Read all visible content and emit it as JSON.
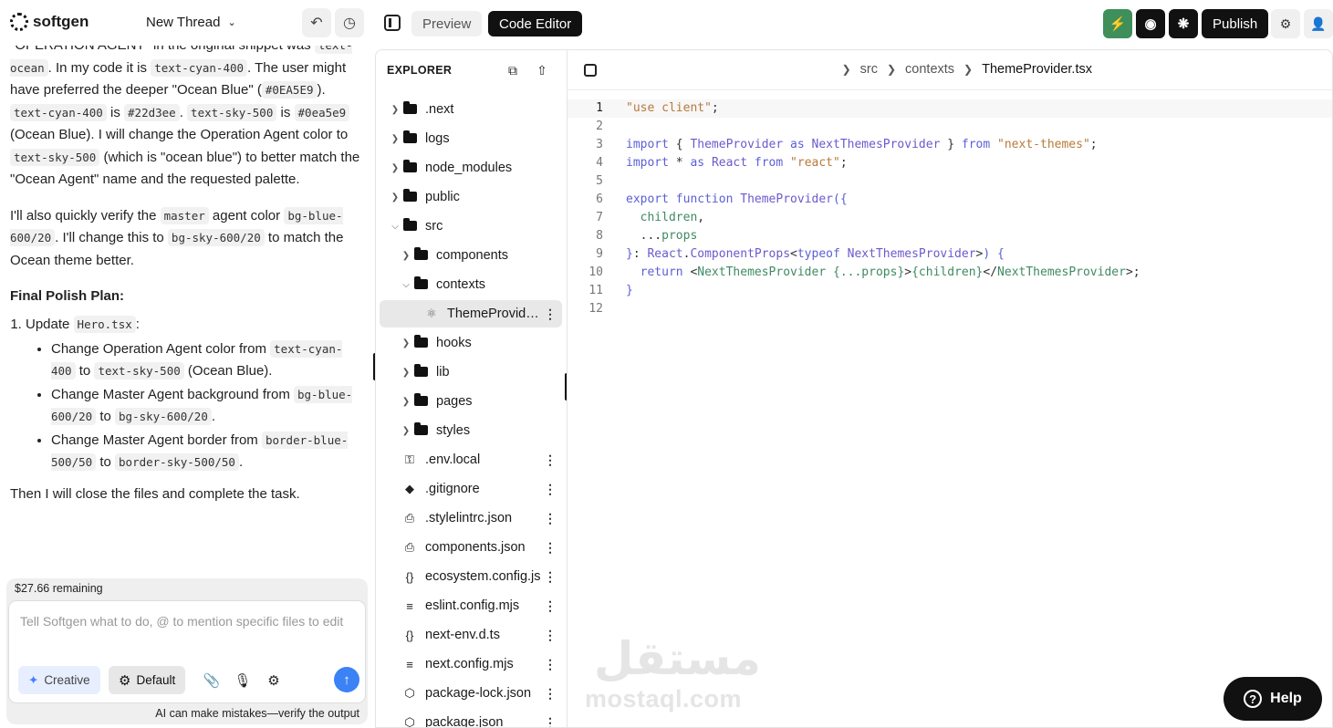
{
  "app": {
    "brand": "softgen",
    "thread_title": "New Thread"
  },
  "chat": {
    "p1": [
      "\"OPERATION AGENT\" in the original snippet was ",
      "text-ocean",
      ". In my code it is ",
      "text-cyan-400",
      ". The user might have preferred the deeper \"Ocean Blue\" (",
      "#0EA5E9",
      "). ",
      "text-cyan-400",
      " is ",
      "#22d3ee",
      ". ",
      "text-sky-500",
      " is ",
      "#0ea5e9",
      " (Ocean Blue). I will change the Operation Agent color to ",
      "text-sky-500",
      " (which is \"ocean blue\") to better match the \"Ocean Agent\" name and the requested palette."
    ],
    "p2": [
      "I'll also quickly verify the ",
      "master",
      " agent color ",
      "bg-blue-600/20",
      ". I'll change this to ",
      "bg-sky-600/20",
      " to match the Ocean theme better."
    ],
    "plan_title": "Final Polish Plan:",
    "step1": [
      "Update ",
      "Hero.tsx",
      ":"
    ],
    "bullets": [
      [
        "Change Operation Agent color from ",
        "text-cyan-400",
        " to ",
        "text-sky-500",
        " (Ocean Blue)."
      ],
      [
        "Change Master Agent background from ",
        "bg-blue-600/20",
        " to ",
        "bg-sky-600/20",
        "."
      ],
      [
        "Change Master Agent border from ",
        "border-blue-500/50",
        " to ",
        "border-sky-500/50",
        "."
      ]
    ],
    "closing": "Then I will close the files and complete the task."
  },
  "composer": {
    "remaining": "$27.66 remaining",
    "placeholder": "Tell Softgen what to do, @ to mention specific files to edit",
    "creative_label": "Creative",
    "default_label": "Default",
    "disclaimer": "AI can make mistakes—verify the output"
  },
  "workspace": {
    "preview_tab": "Preview",
    "code_tab": "Code Editor",
    "publish_label": "Publish",
    "accent_green": "#3f8f5a"
  },
  "explorer": {
    "title": "EXPLORER",
    "items": [
      {
        "name": ".next",
        "type": "folder",
        "depth": 0,
        "open": false
      },
      {
        "name": "logs",
        "type": "folder",
        "depth": 0,
        "open": false
      },
      {
        "name": "node_modules",
        "type": "folder",
        "depth": 0,
        "open": false
      },
      {
        "name": "public",
        "type": "folder",
        "depth": 0,
        "open": false
      },
      {
        "name": "src",
        "type": "folder",
        "depth": 0,
        "open": true
      },
      {
        "name": "components",
        "type": "folder",
        "depth": 1,
        "open": false
      },
      {
        "name": "contexts",
        "type": "folder",
        "depth": 1,
        "open": true
      },
      {
        "name": "ThemeProvider.tsx",
        "type": "file",
        "depth": 2,
        "icon": "react-icon",
        "active": true
      },
      {
        "name": "hooks",
        "type": "folder",
        "depth": 1,
        "open": false
      },
      {
        "name": "lib",
        "type": "folder",
        "depth": 1,
        "open": false
      },
      {
        "name": "pages",
        "type": "folder",
        "depth": 1,
        "open": false
      },
      {
        "name": "styles",
        "type": "folder",
        "depth": 1,
        "open": false
      },
      {
        "name": ".env.local",
        "type": "file",
        "depth": 0,
        "icon": "key-icon"
      },
      {
        "name": ".gitignore",
        "type": "file",
        "depth": 0,
        "icon": "git-icon"
      },
      {
        "name": ".stylelintrc.json",
        "type": "file",
        "depth": 0,
        "icon": "file-code-icon"
      },
      {
        "name": "components.json",
        "type": "file",
        "depth": 0,
        "icon": "file-code-icon"
      },
      {
        "name": "ecosystem.config.js",
        "type": "file",
        "depth": 0,
        "icon": "braces-icon"
      },
      {
        "name": "eslint.config.mjs",
        "type": "file",
        "depth": 0,
        "icon": "settings-lines-icon"
      },
      {
        "name": "next-env.d.ts",
        "type": "file",
        "depth": 0,
        "icon": "braces-icon"
      },
      {
        "name": "next.config.mjs",
        "type": "file",
        "depth": 0,
        "icon": "settings-lines-icon"
      },
      {
        "name": "package-lock.json",
        "type": "file",
        "depth": 0,
        "icon": "package-icon"
      },
      {
        "name": "package.json",
        "type": "file",
        "depth": 0,
        "icon": "package-icon"
      }
    ]
  },
  "editor": {
    "breadcrumb": [
      "src",
      "contexts",
      "ThemeProvider.tsx"
    ],
    "current_line": 1,
    "lines": [
      [
        [
          "str",
          "\"use client\""
        ],
        [
          "pn",
          ";"
        ]
      ],
      [],
      [
        [
          "kw",
          "import"
        ],
        [
          "pn",
          " { "
        ],
        [
          "fn",
          "ThemeProvider"
        ],
        [
          "kw",
          " as "
        ],
        [
          "fn",
          "NextThemesProvider"
        ],
        [
          "pn",
          " } "
        ],
        [
          "kw",
          "from"
        ],
        [
          "pn",
          " "
        ],
        [
          "str",
          "\"next-themes\""
        ],
        [
          "pn",
          ";"
        ]
      ],
      [
        [
          "kw",
          "import"
        ],
        [
          "pn",
          " * "
        ],
        [
          "kw",
          "as"
        ],
        [
          "pn",
          " "
        ],
        [
          "fn",
          "React"
        ],
        [
          "pn",
          " "
        ],
        [
          "kw",
          "from"
        ],
        [
          "pn",
          " "
        ],
        [
          "str",
          "\"react\""
        ],
        [
          "pn",
          ";"
        ]
      ],
      [],
      [
        [
          "kw",
          "export"
        ],
        [
          "pn",
          " "
        ],
        [
          "kw",
          "function"
        ],
        [
          "pn",
          " "
        ],
        [
          "fn",
          "ThemeProvider"
        ],
        [
          "kw",
          "({"
        ]
      ],
      [
        [
          "pn",
          "  "
        ],
        [
          "vr",
          "children"
        ],
        [
          "pn",
          ","
        ]
      ],
      [
        [
          "pn",
          "  ..."
        ],
        [
          "vr",
          "props"
        ]
      ],
      [
        [
          "kw",
          "}"
        ],
        [
          "pn",
          ": "
        ],
        [
          "fn",
          "React"
        ],
        [
          "pn",
          "."
        ],
        [
          "fn",
          "ComponentProps"
        ],
        [
          "pn",
          "<"
        ],
        [
          "kw",
          "typeof"
        ],
        [
          "pn",
          " "
        ],
        [
          "fn",
          "NextThemesProvider"
        ],
        [
          "pn",
          ">"
        ],
        [
          "kw",
          ") {"
        ]
      ],
      [
        [
          "pn",
          "  "
        ],
        [
          "kw",
          "return"
        ],
        [
          "pn",
          " <"
        ],
        [
          "vr",
          "NextThemesProvider"
        ],
        [
          "pn",
          " "
        ],
        [
          "vr",
          "{...props}"
        ],
        [
          "pn",
          ">"
        ],
        [
          "vr",
          "{children}"
        ],
        [
          "pn",
          "</"
        ],
        [
          "vr",
          "NextThemesProvider"
        ],
        [
          "pn",
          ">;"
        ]
      ],
      [
        [
          "kw",
          "}"
        ]
      ],
      []
    ]
  },
  "watermark": {
    "arabic": "مستقل",
    "latin": "mostaql.com"
  },
  "help_label": "Help"
}
